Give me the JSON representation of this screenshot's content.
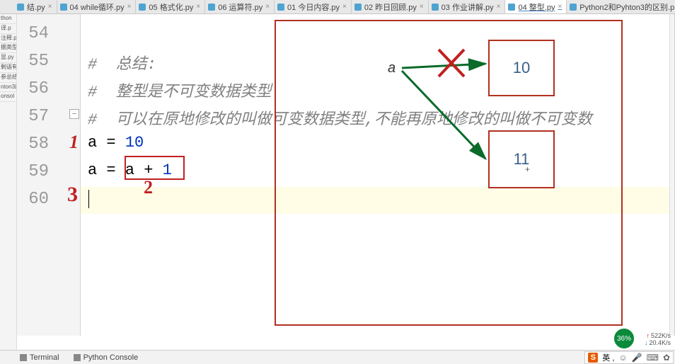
{
  "tabs": [
    {
      "label": "结.py"
    },
    {
      "label": "04 while循环.py"
    },
    {
      "label": "05 格式化.py"
    },
    {
      "label": "06 运算符.py"
    },
    {
      "label": "01 今日内容.py"
    },
    {
      "label": "02 昨日回顾.py"
    },
    {
      "label": "03 作业讲解.py"
    },
    {
      "label": "04 整型.py",
      "active": true
    },
    {
      "label": "Python2和Pyhton3的区别.p"
    }
  ],
  "left_tool_windows": [
    "thon",
    "译.p",
    "注释.p",
    "据类型",
    "显.py",
    "剩语有",
    "参总结",
    "nton3的",
    "onsol"
  ],
  "lines": {
    "54": "54",
    "55": "55",
    "56": "56",
    "57": "57",
    "58": "58",
    "59": "59",
    "60": "60"
  },
  "code": {
    "l55": "#  总结:",
    "l56": "#  整型是不可变数据类型",
    "l57": "#  可以在原地修改的叫做可变数据类型,不能再原地修改的叫做不可变数",
    "l58_a": "a",
    "l58_eq": " = ",
    "l58_n": "10",
    "l59_a": "a",
    "l59_eq": " = ",
    "l59_exp_a": "a",
    "l59_exp_op": " + ",
    "l59_exp_n": "1"
  },
  "annotations": {
    "mark1": "1",
    "mark2": "2",
    "mark3": "3"
  },
  "diagram": {
    "var_label": "a",
    "box1": "10",
    "box2": "11"
  },
  "bottom": {
    "terminal": "Terminal",
    "console": "Python Console"
  },
  "badge": "36%",
  "net": {
    "up": "522K/s",
    "down": "20.4K/s"
  },
  "ime": {
    "logo": "S",
    "lang": "英 ,"
  }
}
